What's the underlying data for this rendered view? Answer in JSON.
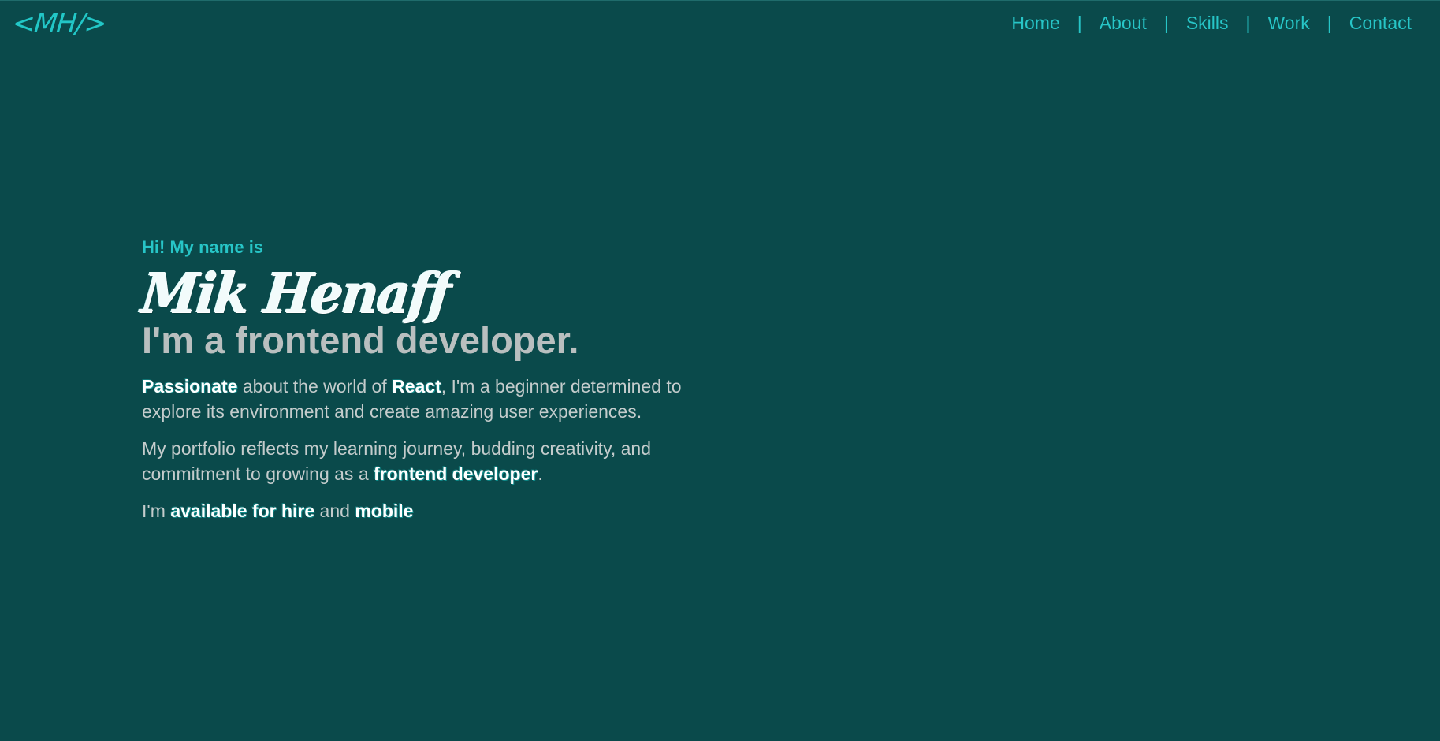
{
  "header": {
    "logo_text": "<MH/>",
    "nav": {
      "items": [
        {
          "label": "Home"
        },
        {
          "label": "About"
        },
        {
          "label": "Skills"
        },
        {
          "label": "Work"
        },
        {
          "label": "Contact"
        }
      ],
      "separator": "|"
    }
  },
  "hero": {
    "greeting": "Hi! My name is",
    "name": "Mik Henaff",
    "role": "I'm a frontend developer.",
    "paragraph1": {
      "hl1": "Passionate",
      "t1": " about the world of ",
      "hl2": "React",
      "t2": ", I'm a beginner determined to explore its environment and create amazing user experiences."
    },
    "paragraph2": {
      "t1": "My portfolio reflects my learning journey, budding creativity, and commitment to growing as a ",
      "hl1": "frontend developer",
      "t2": "."
    },
    "paragraph3": {
      "t1": "I'm ",
      "hl1": "available for hire",
      "t2": " and ",
      "hl2": "mobile"
    }
  },
  "colors": {
    "background": "#0a4a4b",
    "accent": "#27c5c7",
    "heading_gray": "#b9bfbf",
    "body_text": "#c4cccc",
    "highlight": "#ffffff"
  }
}
